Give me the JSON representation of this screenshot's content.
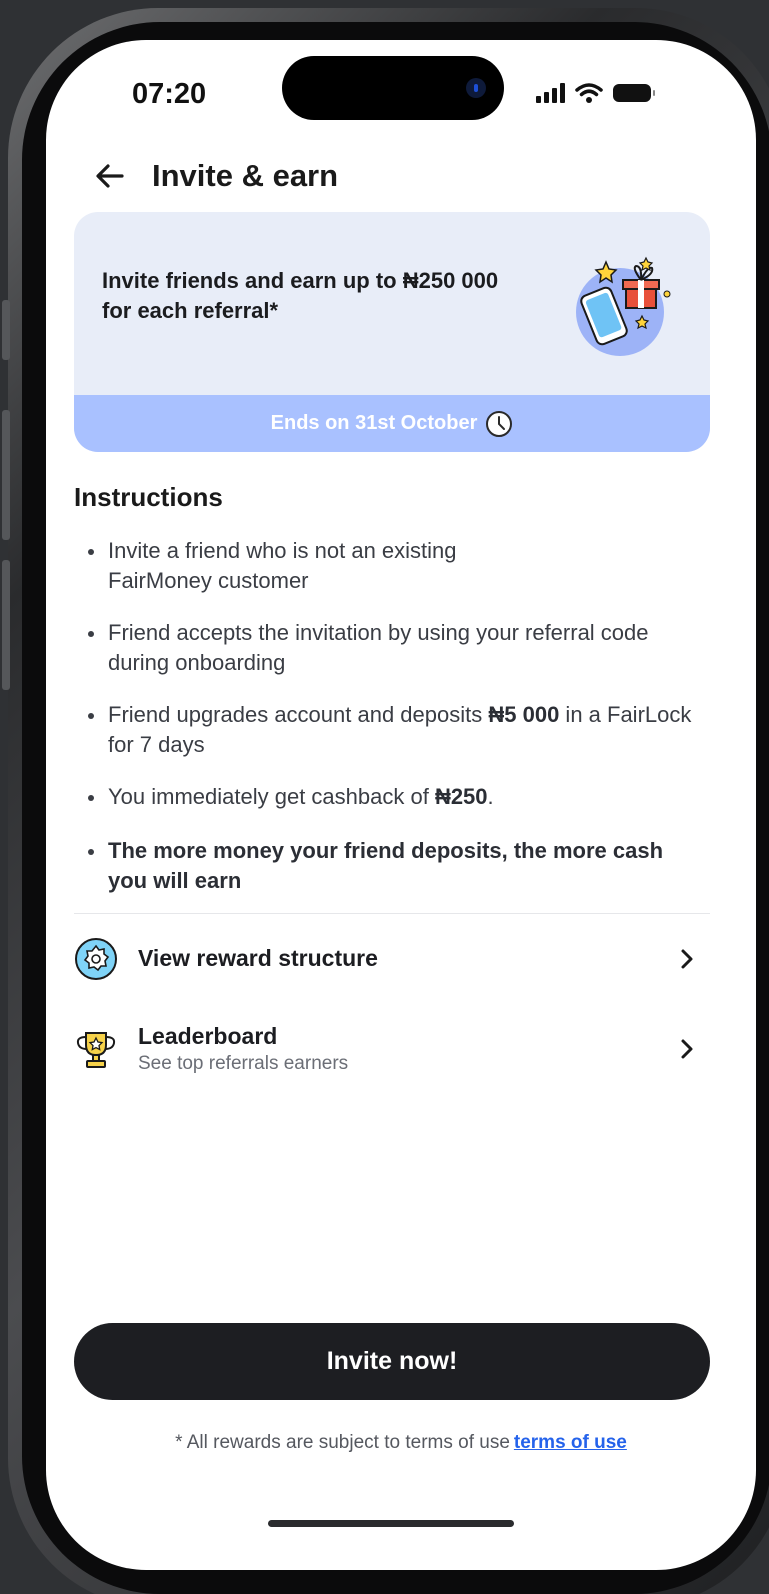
{
  "status_bar": {
    "time": "07:20"
  },
  "header": {
    "title": "Invite & earn"
  },
  "promo": {
    "text": "Invite friends and earn up to ₦250 000 for each referral*",
    "footer": "Ends on 31st October"
  },
  "instructions": {
    "title": "Instructions",
    "items": [
      {
        "pre": "Invite a friend who is not an existing FairMoney customer",
        "bold": "",
        "post": ""
      },
      {
        "pre": "Friend accepts the invitation by using your referral code during onboarding",
        "bold": "",
        "post": ""
      },
      {
        "pre": "Friend upgrades account and deposits ",
        "bold": "₦5 000",
        "post": " in a FairLock for 7 days"
      },
      {
        "pre": "You immediately get cashback of ",
        "bold": "₦250",
        "post": "."
      },
      {
        "pre": "The more money your friend deposits, the more cash you will earn",
        "bold": "",
        "post": ""
      }
    ]
  },
  "rows": {
    "reward": {
      "title": "View reward structure"
    },
    "leaderboard": {
      "title": "Leaderboard",
      "subtitle": "See top referrals earners"
    }
  },
  "cta": {
    "label": "Invite now!"
  },
  "terms": {
    "text": "* All rewards are subject to terms of use",
    "link": "terms of use"
  },
  "colors": {
    "promo_bg": "#e8edf8",
    "promo_footer": "#a9c1ff",
    "cta_bg": "#1d1e22",
    "link": "#2563eb"
  },
  "icons": {
    "back": "arrow-left-icon",
    "promo": "phone-gift-illustration",
    "clock": "clock-icon",
    "reward": "gear-badge-icon",
    "leaderboard": "trophy-icon",
    "chevron": "chevron-right-icon"
  }
}
